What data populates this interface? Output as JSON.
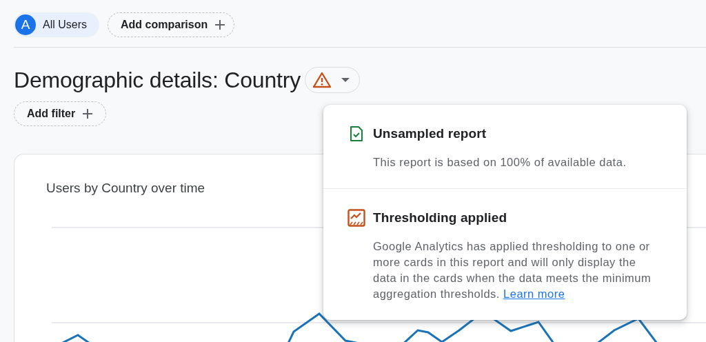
{
  "segments": {
    "chips": [
      {
        "avatar": "A",
        "label": "All Users"
      }
    ],
    "add_comparison": "Add comparison"
  },
  "heading": {
    "title": "Demographic details: Country",
    "add_filter": "Add filter"
  },
  "card": {
    "title": "Users by Country over time"
  },
  "popover": {
    "sections": [
      {
        "kind": "unsampled",
        "title": "Unsampled report",
        "body": "This report is based on 100% of available data."
      },
      {
        "kind": "thresholding",
        "title": "Thresholding applied",
        "body": "Google Analytics has applied thresholding to one or more cards in this report and will only display the data in the cards when the data meets the minimum aggregation thresholds.",
        "link": "Learn more"
      }
    ]
  }
}
